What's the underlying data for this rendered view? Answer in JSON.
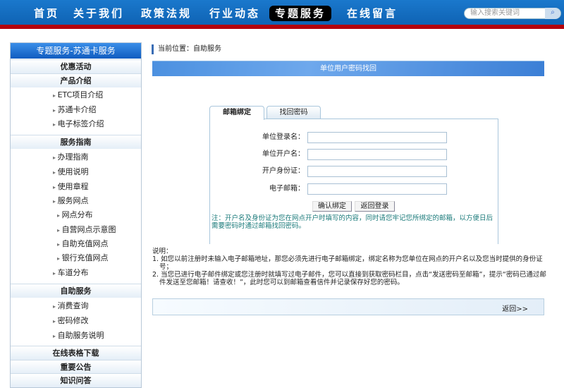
{
  "nav": {
    "items": [
      "首页",
      "关于我们",
      "政策法规",
      "行业动态",
      "专题服务",
      "在线留言"
    ],
    "active_index": 4,
    "search_placeholder": "输入搜索关键词"
  },
  "sidebar": {
    "title": "专题服务-苏通卡服务",
    "items": [
      {
        "label": "优惠活动",
        "type": "cat"
      },
      {
        "label": "产品介绍",
        "type": "cat"
      },
      {
        "label": "ETC项目介绍",
        "type": "sub"
      },
      {
        "label": "苏通卡介绍",
        "type": "sub"
      },
      {
        "label": "电子标签介绍",
        "type": "sub"
      },
      {
        "label": "服务指南",
        "type": "cat"
      },
      {
        "label": "办理指南",
        "type": "sub"
      },
      {
        "label": "使用说明",
        "type": "sub"
      },
      {
        "label": "使用章程",
        "type": "sub"
      },
      {
        "label": "服务网点",
        "type": "sub"
      },
      {
        "label": "网点分布",
        "type": "sub2"
      },
      {
        "label": "自营网点示意图",
        "type": "sub2"
      },
      {
        "label": "自助充值网点",
        "type": "sub2"
      },
      {
        "label": "银行充值网点",
        "type": "sub2"
      },
      {
        "label": "车道分布",
        "type": "sub"
      },
      {
        "label": "自助服务",
        "type": "cat"
      },
      {
        "label": "消费查询",
        "type": "sub"
      },
      {
        "label": "密码修改",
        "type": "sub"
      },
      {
        "label": "自助服务说明",
        "type": "sub"
      },
      {
        "label": "在线表格下载",
        "type": "cat"
      },
      {
        "label": "重要公告",
        "type": "cat"
      },
      {
        "label": "知识问答",
        "type": "cat"
      }
    ]
  },
  "main": {
    "breadcrumb": "当前位置：自助服务",
    "banner": "单位用户密码找回",
    "tabs": [
      "邮箱绑定",
      "找回密码"
    ],
    "form": {
      "fields": [
        "单位登录名：",
        "单位开户名：",
        "开户身份证：",
        "电子邮箱："
      ],
      "confirm": "确认绑定",
      "back_login": "返回登录"
    },
    "note": "注：开户名及身份证为您在网点开户时填写的内容，同时请您牢记您所绑定的邮箱，以方便日后需要密码时通过邮箱找回密码。",
    "instructions": {
      "title": "说明：",
      "items": [
        "1. 如您以前注册时未输入电子邮箱地址，那您必须先进行电子邮箱绑定，绑定名称为您单位在网点的开户名以及您当时提供的身份证号；",
        "2. 当您已进行电子邮件绑定或您注册时就填写过电子邮件，您可以直接到获取密码栏目，点击“发送密码至邮箱”，提示“密码已通过邮件发送至您邮箱！请查收！”，此时您可以到邮箱查看信件并记录保存好您的密码。"
      ]
    },
    "return": "返回>>"
  }
}
